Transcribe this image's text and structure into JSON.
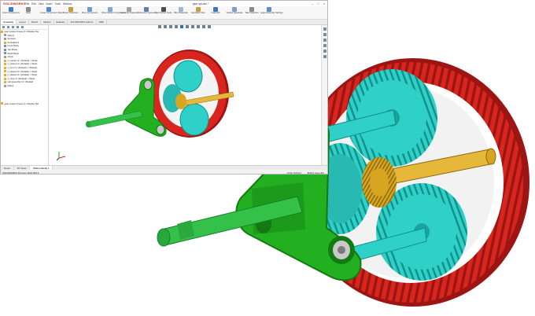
{
  "app": {
    "brand": "SOLIDWORKS",
    "menus": [
      "File",
      "Edit",
      "View",
      "Insert",
      "Tools",
      "Window"
    ],
    "document_title": "gear sys.iam *"
  },
  "window_controls": [
    "–",
    "□",
    "×"
  ],
  "commands": [
    {
      "label": "Insert Components"
    },
    {
      "label": "Mate"
    },
    {
      "label": "Linear Component Pattern"
    },
    {
      "label": "Smart Fasteners"
    },
    {
      "label": "Move Component"
    },
    {
      "label": "Show Hidden Components"
    },
    {
      "label": "Assembly Features"
    },
    {
      "label": "Reference Geometry"
    },
    {
      "label": "New Motion Study"
    },
    {
      "label": "Bill of Materials"
    },
    {
      "label": "Exploded View"
    },
    {
      "label": "Instant3D"
    },
    {
      "label": "Update Speedpak"
    },
    {
      "label": "Take Snapshot"
    },
    {
      "label": "Large Assembly Settings"
    }
  ],
  "command_tabs": [
    "Assembly",
    "Layout",
    "Sketch",
    "Markup",
    "Evaluate",
    "SOLIDWORKS Add-Ins",
    "MBD"
  ],
  "tree": {
    "nodes": [
      {
        "label": "gear system (Issue 2) <Display Sta"
      },
      {
        "label": "History"
      },
      {
        "label": "Sensors"
      },
      {
        "label": "Annotations"
      },
      {
        "label": "Front Plane"
      },
      {
        "label": "Top Plane"
      },
      {
        "label": "Right Plane"
      },
      {
        "label": "Origin"
      },
      {
        "label": "(-) carrier<1> (Default) <<Defa"
      },
      {
        "label": "(-) planet<1> (Default) <<Defa"
      },
      {
        "label": "(-) sun<1> (Default) <<Default"
      },
      {
        "label": "(-) planet<2> (Default) <<Defa"
      },
      {
        "label": "(-) planet<3> (Default) <<Defa"
      },
      {
        "label": "(-) ring<1> (Default) <<Defa"
      },
      {
        "label": "sub assembly<1> (Default"
      },
      {
        "label": "Mates"
      }
    ],
    "bottom_label": "gear system (Issue 2) <Display Sta"
  },
  "bottom_tabs": [
    "Model",
    "3D Views",
    "Motion Study 1"
  ],
  "status": {
    "left": "SOLIDWORKS Premium 2019 SP2.0",
    "right": [
      "Under Defined",
      "Editing Assembly"
    ]
  },
  "render": {
    "colors": {
      "ring": "#d8261f",
      "ring_dark": "#9c1512",
      "planet": "#2fd0c8",
      "planet_dark": "#14908a",
      "carrier": "#22b020",
      "carrier_dark": "#137a12",
      "sun": "#d7a520",
      "sun_dark": "#8e6a10",
      "shaft": "#33c14a"
    }
  }
}
